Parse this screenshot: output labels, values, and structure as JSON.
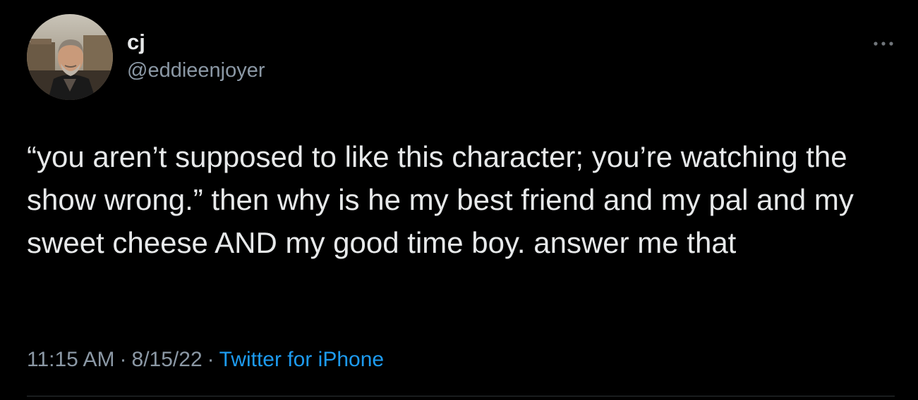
{
  "author": {
    "display_name": "cj",
    "handle": "@eddieenjoyer"
  },
  "tweet": {
    "text": "“you aren’t supposed to like this character; you’re watching the show wrong.” then why is he my best friend and my pal and my sweet cheese AND my good time boy. answer me that",
    "time": "11:15 AM",
    "separator": "·",
    "date": "8/15/22",
    "source": "Twitter for iPhone"
  },
  "icons": {
    "more": "more-horizontal-icon",
    "avatar": "profile-photo"
  },
  "colors": {
    "background": "#000000",
    "primary_text": "#e7e9ea",
    "secondary_text": "#8b98a5",
    "link": "#1d9bf0",
    "divider": "#2f3336"
  }
}
